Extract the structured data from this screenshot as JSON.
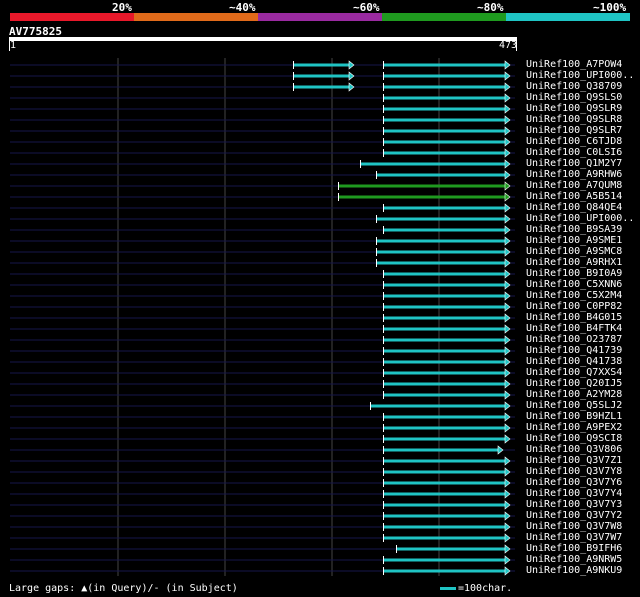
{
  "legend": {
    "labels": [
      "20%",
      "~40%",
      "~60%",
      "~80%",
      "~100%"
    ],
    "colors": [
      "#e8182a",
      "#e06a1a",
      "#9a2aa0",
      "#1f9a1f",
      "#1fc4c4"
    ]
  },
  "query": {
    "id": "AV775825",
    "start": "1",
    "end": "473"
  },
  "hits": [
    {
      "name": "UniRef100_A7POW4",
      "color": "#1fc4c4",
      "segments": [
        [
          293,
          349
        ],
        [
          383,
          505
        ]
      ]
    },
    {
      "name": "UniRef100_UPI000..",
      "color": "#1fc4c4",
      "segments": [
        [
          293,
          349
        ],
        [
          383,
          505
        ]
      ]
    },
    {
      "name": "UniRef100_Q38709",
      "color": "#1fc4c4",
      "segments": [
        [
          293,
          349
        ],
        [
          383,
          505
        ]
      ]
    },
    {
      "name": "UniRef100_Q9SLS0",
      "color": "#1fc4c4",
      "segments": [
        [
          383,
          505
        ]
      ]
    },
    {
      "name": "UniRef100_Q9SLR9",
      "color": "#1fc4c4",
      "segments": [
        [
          383,
          505
        ]
      ]
    },
    {
      "name": "UniRef100_Q9SLR8",
      "color": "#1fc4c4",
      "segments": [
        [
          383,
          505
        ]
      ]
    },
    {
      "name": "UniRef100_Q9SLR7",
      "color": "#1fc4c4",
      "segments": [
        [
          383,
          505
        ]
      ]
    },
    {
      "name": "UniRef100_C6TJD8",
      "color": "#1fc4c4",
      "segments": [
        [
          383,
          505
        ]
      ]
    },
    {
      "name": "UniRef100_C0LSI6",
      "color": "#1fc4c4",
      "segments": [
        [
          383,
          505
        ]
      ]
    },
    {
      "name": "UniRef100_Q1M2Y7",
      "color": "#1fc4c4",
      "segments": [
        [
          360,
          505
        ]
      ]
    },
    {
      "name": "UniRef100_A9RHW6",
      "color": "#1fc4c4",
      "segments": [
        [
          376,
          505
        ]
      ]
    },
    {
      "name": "UniRef100_A7QUM8",
      "color": "#1f9a1f",
      "segments": [
        [
          338,
          505
        ]
      ]
    },
    {
      "name": "UniRef100_A5B514",
      "color": "#1f9a1f",
      "segments": [
        [
          338,
          505
        ]
      ]
    },
    {
      "name": "UniRef100_Q84QE4",
      "color": "#1fc4c4",
      "segments": [
        [
          383,
          505
        ]
      ]
    },
    {
      "name": "UniRef100_UPI000..",
      "color": "#1fc4c4",
      "segments": [
        [
          376,
          505
        ]
      ]
    },
    {
      "name": "UniRef100_B9SA39",
      "color": "#1fc4c4",
      "segments": [
        [
          383,
          505
        ]
      ]
    },
    {
      "name": "UniRef100_A9SME1",
      "color": "#1fc4c4",
      "segments": [
        [
          376,
          505
        ]
      ]
    },
    {
      "name": "UniRef100_A9SMC8",
      "color": "#1fc4c4",
      "segments": [
        [
          376,
          505
        ]
      ]
    },
    {
      "name": "UniRef100_A9RHX1",
      "color": "#1fc4c4",
      "segments": [
        [
          376,
          505
        ]
      ]
    },
    {
      "name": "UniRef100_B9I0A9",
      "color": "#1fc4c4",
      "segments": [
        [
          383,
          505
        ]
      ]
    },
    {
      "name": "UniRef100_C5XNN6",
      "color": "#1fc4c4",
      "segments": [
        [
          383,
          505
        ]
      ]
    },
    {
      "name": "UniRef100_C5X2M4",
      "color": "#1fc4c4",
      "segments": [
        [
          383,
          505
        ]
      ]
    },
    {
      "name": "UniRef100_C0PP82",
      "color": "#1fc4c4",
      "segments": [
        [
          383,
          505
        ]
      ]
    },
    {
      "name": "UniRef100_B4G015",
      "color": "#1fc4c4",
      "segments": [
        [
          383,
          505
        ]
      ]
    },
    {
      "name": "UniRef100_B4FTK4",
      "color": "#1fc4c4",
      "segments": [
        [
          383,
          505
        ]
      ]
    },
    {
      "name": "UniRef100_O23787",
      "color": "#1fc4c4",
      "segments": [
        [
          383,
          505
        ]
      ]
    },
    {
      "name": "UniRef100_Q41739",
      "color": "#1fc4c4",
      "segments": [
        [
          383,
          505
        ]
      ]
    },
    {
      "name": "UniRef100_Q41738",
      "color": "#1fc4c4",
      "segments": [
        [
          383,
          505
        ]
      ]
    },
    {
      "name": "UniRef100_Q7XXS4",
      "color": "#1fc4c4",
      "segments": [
        [
          383,
          505
        ]
      ]
    },
    {
      "name": "UniRef100_Q20IJ5",
      "color": "#1fc4c4",
      "segments": [
        [
          383,
          505
        ]
      ]
    },
    {
      "name": "UniRef100_A2YM28",
      "color": "#1fc4c4",
      "segments": [
        [
          383,
          505
        ]
      ]
    },
    {
      "name": "UniRef100_Q5SLJ2",
      "color": "#1fc4c4",
      "segments": [
        [
          370,
          505
        ]
      ]
    },
    {
      "name": "UniRef100_B9HZL1",
      "color": "#1fc4c4",
      "segments": [
        [
          383,
          505
        ]
      ]
    },
    {
      "name": "UniRef100_A9PEX2",
      "color": "#1fc4c4",
      "segments": [
        [
          383,
          505
        ]
      ]
    },
    {
      "name": "UniRef100_Q9SCI8",
      "color": "#1fc4c4",
      "segments": [
        [
          383,
          505
        ]
      ]
    },
    {
      "name": "UniRef100_Q3V806",
      "color": "#1fc4c4",
      "segments": [
        [
          383,
          498
        ]
      ]
    },
    {
      "name": "UniRef100_Q3V7Z1",
      "color": "#1fc4c4",
      "segments": [
        [
          383,
          505
        ]
      ]
    },
    {
      "name": "UniRef100_Q3V7Y8",
      "color": "#1fc4c4",
      "segments": [
        [
          383,
          505
        ]
      ]
    },
    {
      "name": "UniRef100_Q3V7Y6",
      "color": "#1fc4c4",
      "segments": [
        [
          383,
          505
        ]
      ]
    },
    {
      "name": "UniRef100_Q3V7Y4",
      "color": "#1fc4c4",
      "segments": [
        [
          383,
          505
        ]
      ]
    },
    {
      "name": "UniRef100_Q3V7Y3",
      "color": "#1fc4c4",
      "segments": [
        [
          383,
          505
        ]
      ]
    },
    {
      "name": "UniRef100_Q3V7Y2",
      "color": "#1fc4c4",
      "segments": [
        [
          383,
          505
        ]
      ]
    },
    {
      "name": "UniRef100_Q3V7W8",
      "color": "#1fc4c4",
      "segments": [
        [
          383,
          505
        ]
      ]
    },
    {
      "name": "UniRef100_Q3V7W7",
      "color": "#1fc4c4",
      "segments": [
        [
          383,
          505
        ]
      ]
    },
    {
      "name": "UniRef100_B9IFH6",
      "color": "#1fc4c4",
      "segments": [
        [
          396,
          505
        ]
      ]
    },
    {
      "name": "UniRef100_A9NRW5",
      "color": "#1fc4c4",
      "segments": [
        [
          383,
          505
        ]
      ]
    },
    {
      "name": "UniRef100_A9NKU9",
      "color": "#1fc4c4",
      "segments": [
        [
          383,
          505
        ]
      ]
    }
  ],
  "footer": {
    "gaps_text": "Large gaps: ▲(in Query)/- (in Subject)",
    "scale_text": "=100char."
  }
}
